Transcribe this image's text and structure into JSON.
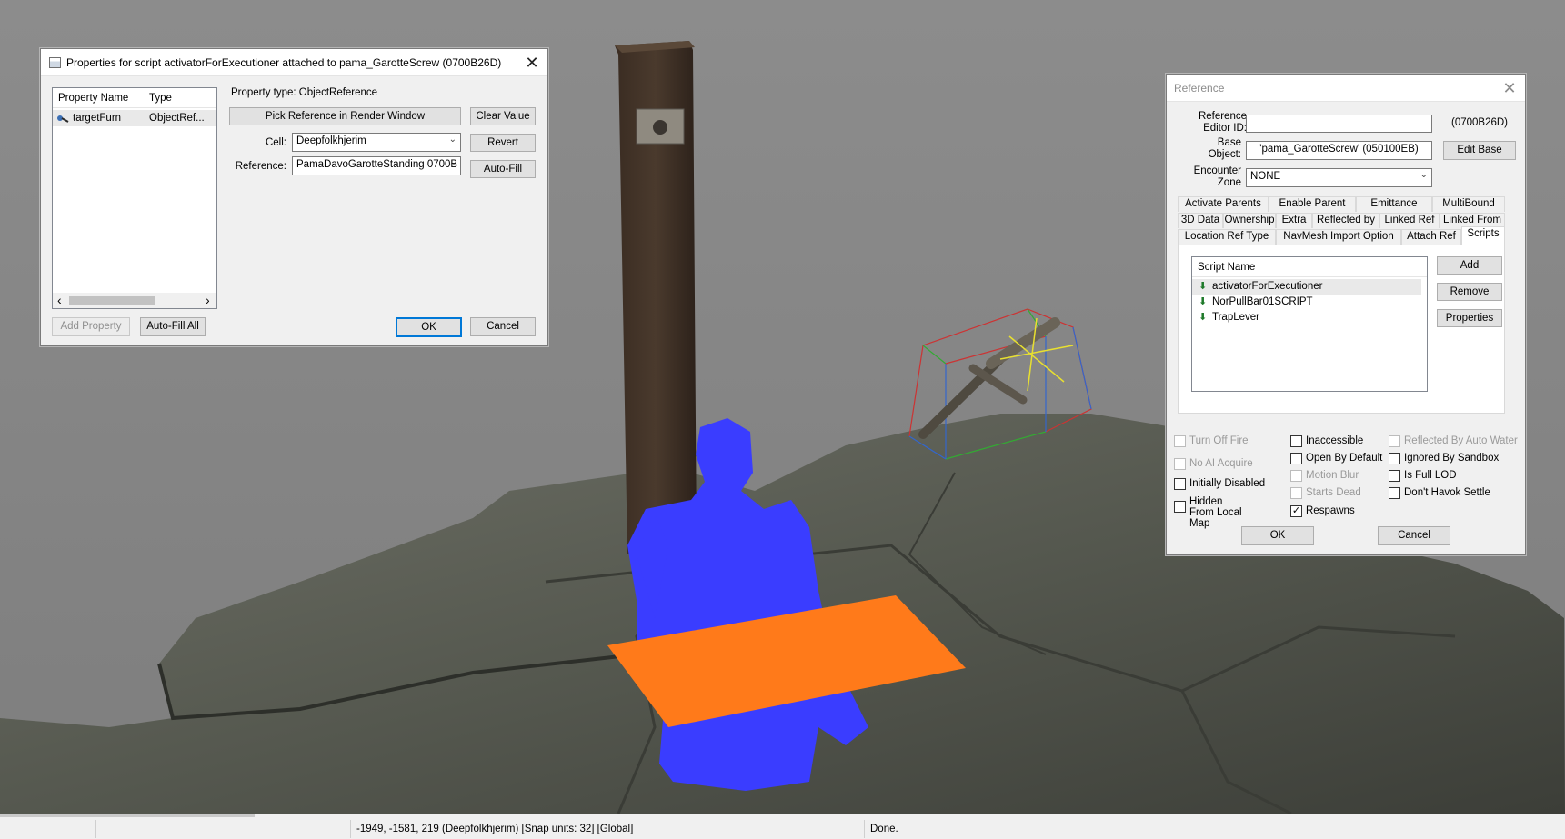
{
  "props_dialog": {
    "title": "Properties for script activatorForExecutioner attached to pama_GarotteScrew (0700B26D)",
    "columns": [
      "Property Name",
      "Type"
    ],
    "rows": [
      {
        "name": "targetFurn",
        "type": "ObjectRef..."
      }
    ],
    "property_type": "Property type: ObjectReference",
    "pick_ref_button": "Pick Reference in Render Window",
    "clear_value_button": "Clear Value",
    "cell_label": "Cell:",
    "cell_value": "Deepfolkhjerim",
    "revert_button": "Revert",
    "reference_label": "Reference:",
    "reference_value": "PamaDavoGarotteStanding 0700B",
    "autofill_button": "Auto-Fill",
    "add_property_button": "Add Property",
    "autofill_all_button": "Auto-Fill All",
    "ok_button": "OK",
    "cancel_button": "Cancel"
  },
  "ref_dialog": {
    "title": "Reference",
    "editor_id_label": "Reference Editor ID:",
    "editor_id_value": "",
    "form_id": "(0700B26D)",
    "base_label": "Base Object:",
    "base_value": "'pama_GarotteScrew' (050100EB)",
    "edit_base_button": "Edit Base",
    "zone_label": "Encounter Zone",
    "zone_value": "NONE",
    "tabs_row1": [
      "Activate Parents",
      "Enable Parent",
      "Emittance",
      "MultiBound"
    ],
    "tabs_row2": [
      "3D Data",
      "Ownership",
      "Extra",
      "Reflected by",
      "Linked Ref",
      "Linked From"
    ],
    "tabs_row3": [
      "Location Ref Type",
      "NavMesh Import Option",
      "Attach Ref",
      "Scripts"
    ],
    "scripts_header": "Script Name",
    "scripts": [
      "activatorForExecutioner",
      "NorPullBar01SCRIPT",
      "TrapLever"
    ],
    "add_button": "Add",
    "remove_button": "Remove",
    "properties_button": "Properties",
    "checkboxes": {
      "turn_off_fire": "Turn Off Fire",
      "no_ai_acquire": "No AI Acquire",
      "initially_disabled": "Initially Disabled",
      "hidden_from_local_map": "Hidden From Local Map",
      "inaccessible": "Inaccessible",
      "open_by_default": "Open By Default",
      "motion_blur": "Motion Blur",
      "starts_dead": "Starts Dead",
      "respawns": "Respawns",
      "reflected_by_auto_water": "Reflected By Auto Water",
      "ignored_by_sandbox": "Ignored By Sandbox",
      "is_full_lod": "Is Full LOD",
      "dont_havok_settle": "Don't Havok Settle",
      "checkmark": "✓"
    },
    "ok_button": "OK",
    "cancel_button": "Cancel"
  },
  "status_bar": {
    "coords": "-1949, -1581, 219 (Deepfolkhjerim) [Snap units: 32] [Global]",
    "message": "Done."
  },
  "icons": {
    "close": "✕",
    "dropdown": "⌄",
    "scroll_left": "‹",
    "scroll_right": "›",
    "script_arrow": "⬇"
  },
  "colors": {
    "selection_blue": "#3a3dff",
    "selection_orange": "#ff7a1a",
    "accent": "#0078d7"
  }
}
